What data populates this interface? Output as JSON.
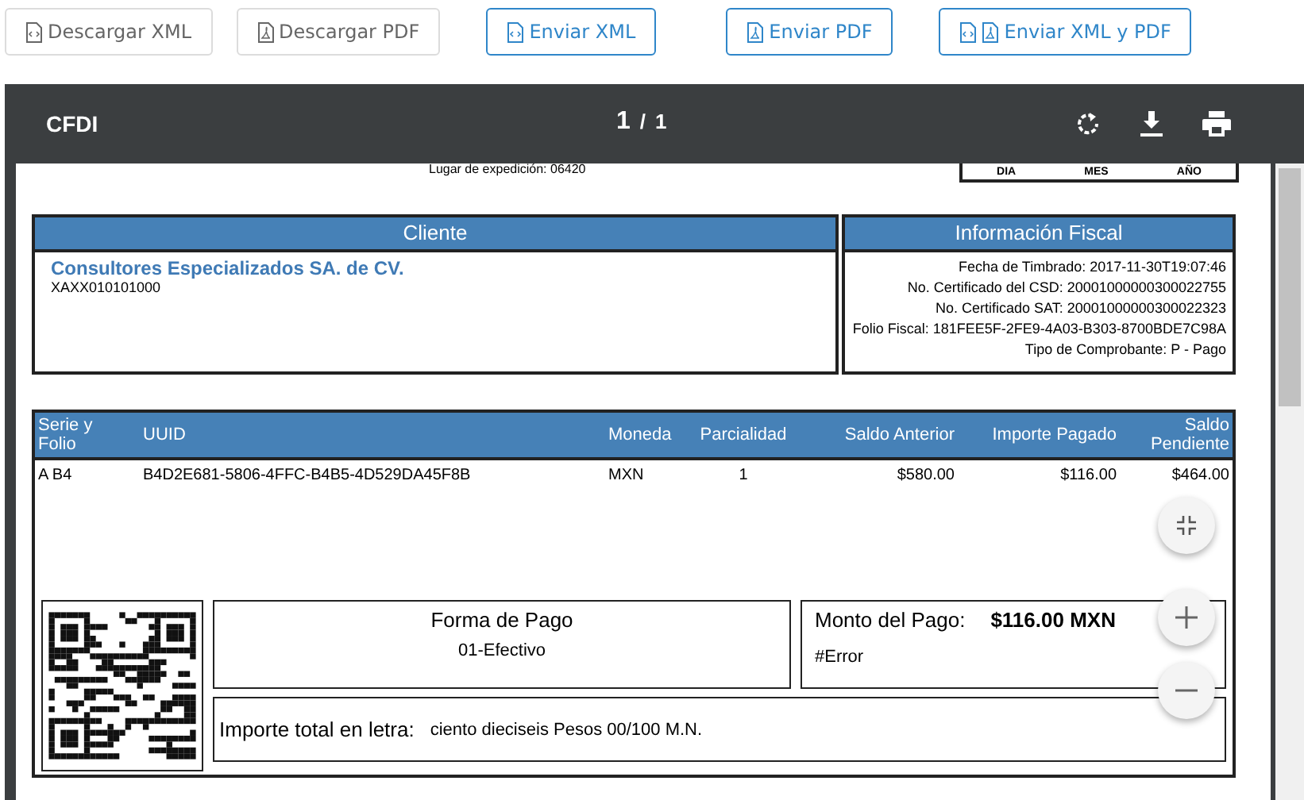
{
  "actions": [
    {
      "label": "Descargar XML",
      "kind": "xml"
    },
    {
      "label": "Descargar PDF",
      "kind": "pdf"
    },
    {
      "label": "Enviar XML",
      "kind": "xml"
    },
    {
      "label": "Enviar PDF",
      "kind": "pdf"
    },
    {
      "label": "Enviar XML y PDF",
      "kind": "both"
    }
  ],
  "viewer": {
    "title": "CFDI",
    "page": "1",
    "separator": "/",
    "total": "1"
  },
  "document": {
    "place": "Lugar de expedición: 06420",
    "date_labels": [
      "DIA",
      "MES",
      "AÑO"
    ],
    "cliente": {
      "heading": "Cliente",
      "name": "Consultores Especializados SA. de CV.",
      "rfc": "XAXX010101000"
    },
    "fiscal": {
      "heading": "Información Fiscal",
      "lines": [
        "Fecha de Timbrado: 2017-11-30T19:07:46",
        "No. Certificado del CSD: 20001000000300022755",
        "No. Certificado SAT: 20001000000300022323",
        "Folio Fiscal: 181FEE5F-2FE9-4A03-B303-8700BDE7C98A",
        "Tipo de Comprobante: P - Pago"
      ]
    },
    "table": {
      "columns": [
        "Serie y Folio",
        "UUID",
        "Moneda",
        "Parcialidad",
        "Saldo Anterior",
        "Importe Pagado",
        "Saldo Pendiente"
      ],
      "rows": [
        [
          "A B4",
          "B4D2E681-5806-4FFC-B4B5-4D529DA45F8B",
          "MXN",
          "1",
          "$580.00",
          "$116.00",
          "$464.00"
        ]
      ]
    },
    "forma": {
      "heading": "Forma de Pago",
      "value": "01-Efectivo"
    },
    "monto": {
      "label": "Monto del Pago:",
      "value": "$116.00 MXN",
      "note": "#Error"
    },
    "letra": {
      "label": "Importe total en letra:",
      "value": "ciento dieciseis Pesos 00/100 M.N."
    }
  }
}
